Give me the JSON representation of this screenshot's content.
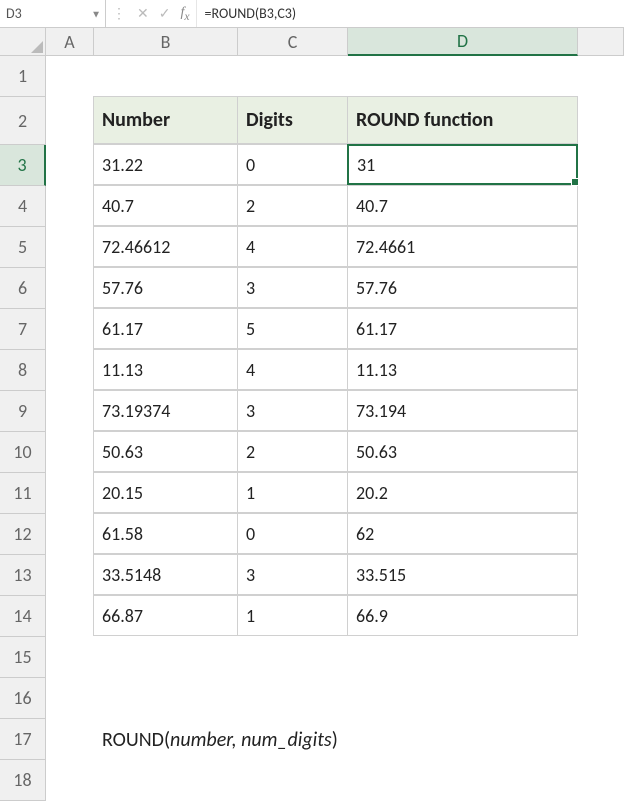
{
  "name_box": "D3",
  "formula": "=ROUND(B3,C3)",
  "columns": [
    "A",
    "B",
    "C",
    "D",
    ""
  ],
  "row_numbers": [
    "1",
    "2",
    "3",
    "4",
    "5",
    "6",
    "7",
    "8",
    "9",
    "10",
    "11",
    "12",
    "13",
    "14",
    "15",
    "16",
    "17",
    "18"
  ],
  "headers": {
    "b": "Number",
    "c": "Digits",
    "d": "ROUND function"
  },
  "rows": [
    {
      "b": "31.22",
      "c": "0",
      "d": "31"
    },
    {
      "b": "40.7",
      "c": "2",
      "d": "40.7"
    },
    {
      "b": "72.46612",
      "c": "4",
      "d": "72.4661"
    },
    {
      "b": "57.76",
      "c": "3",
      "d": "57.76"
    },
    {
      "b": "61.17",
      "c": "5",
      "d": "61.17"
    },
    {
      "b": "11.13",
      "c": "4",
      "d": "11.13"
    },
    {
      "b": "73.19374",
      "c": "3",
      "d": "73.194"
    },
    {
      "b": "50.63",
      "c": "2",
      "d": "50.63"
    },
    {
      "b": "20.15",
      "c": "1",
      "d": "20.2"
    },
    {
      "b": "61.58",
      "c": "0",
      "d": "62"
    },
    {
      "b": "33.5148",
      "c": "3",
      "d": "33.515"
    },
    {
      "b": "66.87",
      "c": "1",
      "d": "66.9"
    }
  ],
  "footer": {
    "fn": "ROUND(",
    "args": "number, num_digits",
    "close": " )"
  },
  "selected": {
    "cell": "D3",
    "col": "D",
    "row": "3"
  }
}
